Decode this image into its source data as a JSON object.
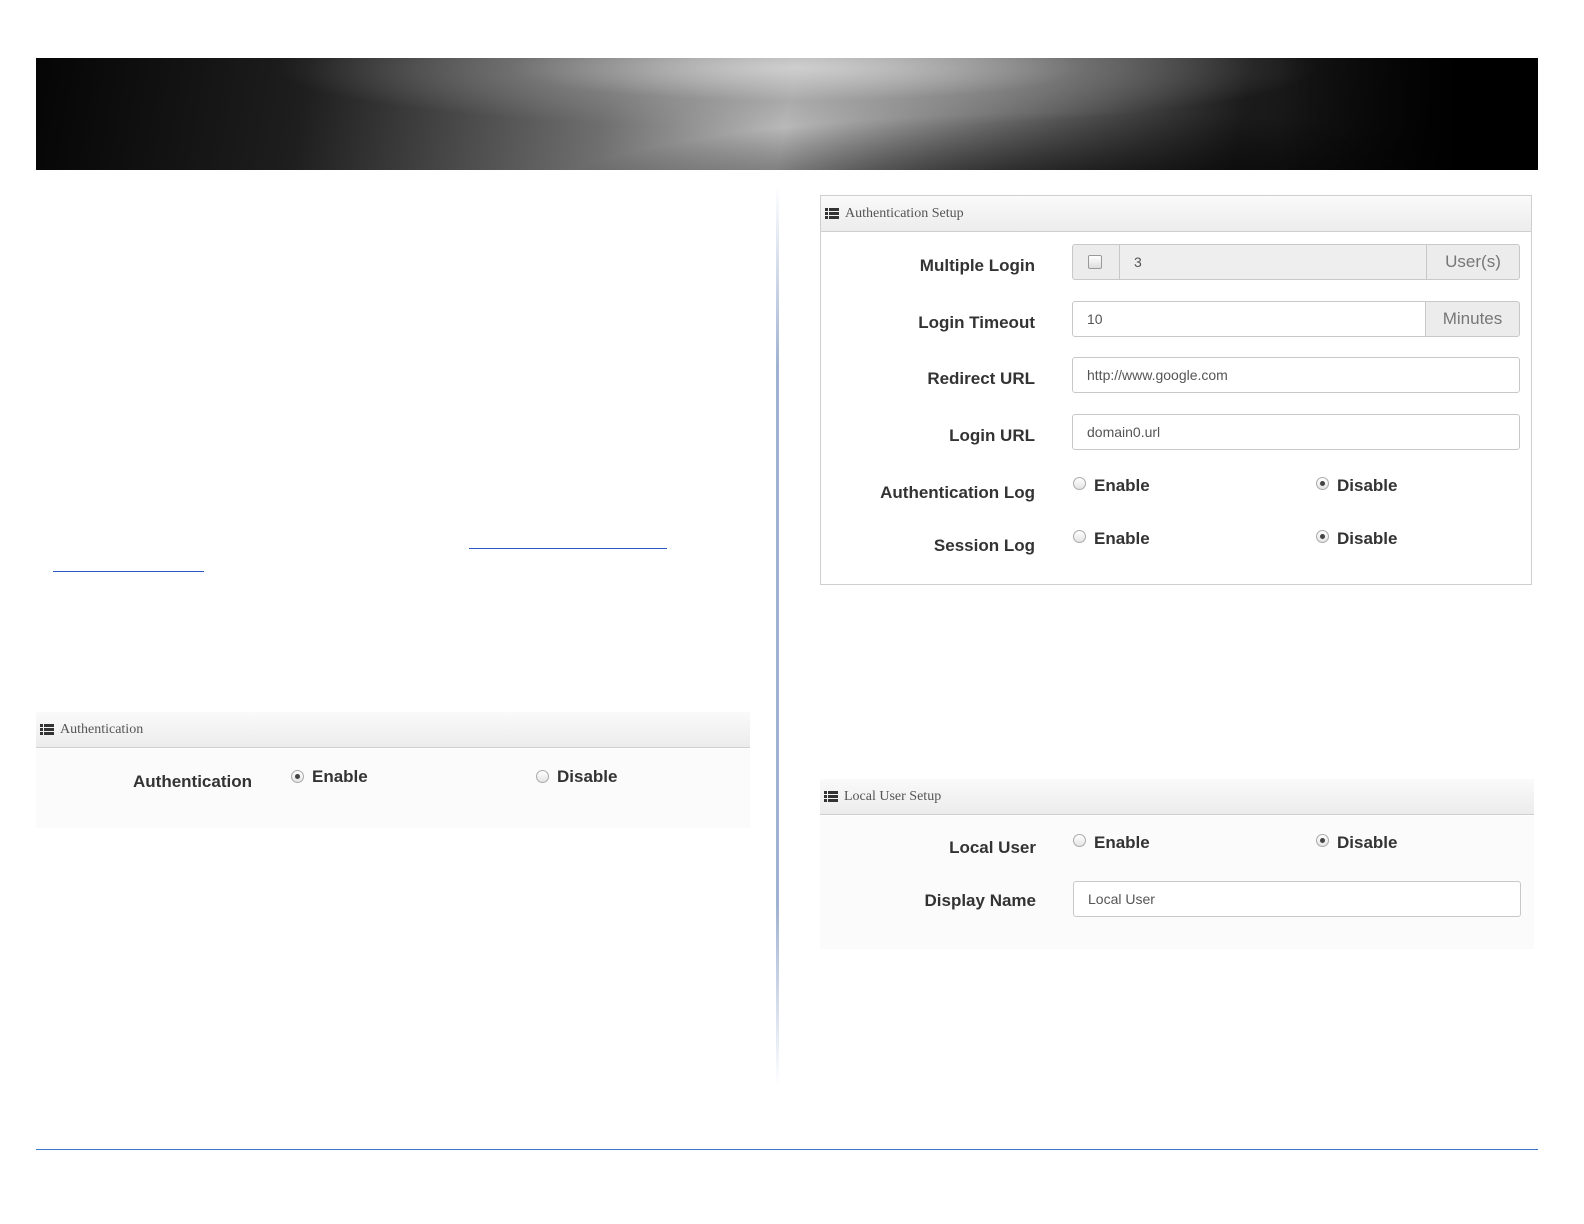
{
  "icons": {
    "panel_header_icon": "list-icon"
  },
  "colors": {
    "divider": "#3a78c9",
    "link": "#2a56c6"
  },
  "auth_panel": {
    "title": "Authentication",
    "label": "Authentication",
    "enable_label": "Enable",
    "disable_label": "Disable",
    "selected": "Enable"
  },
  "auth_setup_panel": {
    "title": "Authentication Setup",
    "multiple_login": {
      "label": "Multiple Login",
      "checked": false,
      "value": "3",
      "unit": "User(s)"
    },
    "login_timeout": {
      "label": "Login Timeout",
      "value": "10",
      "unit": "Minutes"
    },
    "redirect_url": {
      "label": "Redirect URL",
      "value": "http://www.google.com"
    },
    "login_url": {
      "label": "Login URL",
      "value": "domain0.url"
    },
    "authentication_log": {
      "label": "Authentication Log",
      "enable_label": "Enable",
      "disable_label": "Disable",
      "selected": "Disable"
    },
    "session_log": {
      "label": "Session Log",
      "enable_label": "Enable",
      "disable_label": "Disable",
      "selected": "Disable"
    }
  },
  "local_user_panel": {
    "title": "Local User Setup",
    "local_user": {
      "label": "Local User",
      "enable_label": "Enable",
      "disable_label": "Disable",
      "selected": "Disable"
    },
    "display_name": {
      "label": "Display Name",
      "value": "Local User"
    }
  }
}
